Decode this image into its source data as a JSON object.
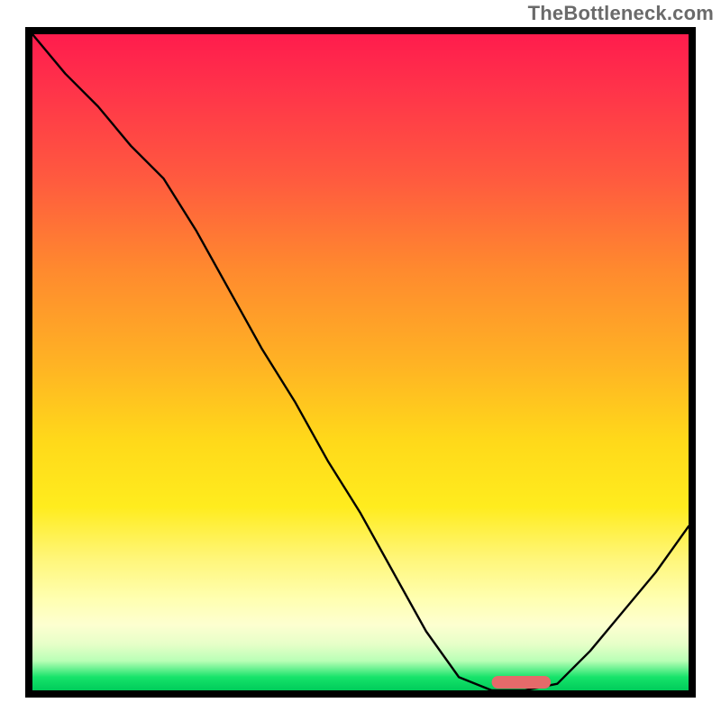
{
  "watermark": "TheBottleneck.com",
  "colors": {
    "frame": "#000000",
    "curve": "#000000",
    "marker": "#e46a6a",
    "gradient_top": "#ff1c4d",
    "gradient_bottom": "#00cc5a"
  },
  "chart_data": {
    "type": "line",
    "title": "",
    "xlabel": "",
    "ylabel": "",
    "xlim": [
      0,
      100
    ],
    "ylim": [
      0,
      100
    ],
    "x": [
      0,
      5,
      10,
      15,
      20,
      25,
      30,
      35,
      40,
      45,
      50,
      55,
      60,
      65,
      70,
      75,
      80,
      85,
      90,
      95,
      100
    ],
    "values": [
      100,
      94,
      89,
      83,
      78,
      70,
      61,
      52,
      44,
      35,
      27,
      18,
      9,
      2,
      0,
      0,
      1,
      6,
      12,
      18,
      25
    ],
    "optimum_range_x": [
      70,
      79
    ],
    "note": "y-value is bottleneck severity (100 = worst / red, 0 = optimal / green). Curve descends from top-left with a slight knee around x≈20, reaches flat 0 around x 70–79 (marked segment), then rises toward bottom-right."
  },
  "marker": {
    "x_start": 70,
    "x_end": 79,
    "thickness_px": 14
  }
}
